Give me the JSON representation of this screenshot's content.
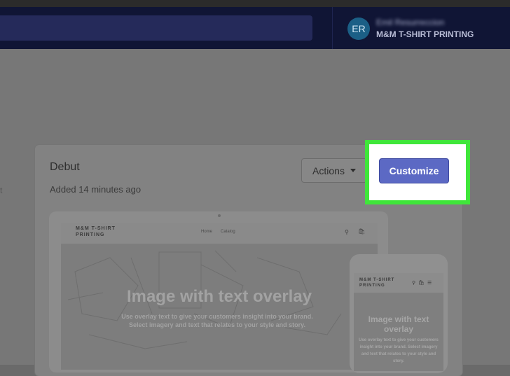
{
  "header": {
    "avatar_initials": "ER",
    "user_name": "Emil Resurreccion",
    "store_name": "M&M T-SHIRT PRINTING"
  },
  "sidebar": {
    "partial_text": "t"
  },
  "theme": {
    "name": "Debut",
    "added": "Added 14 minutes ago",
    "actions_label": "Actions",
    "customize_label": "Customize"
  },
  "preview": {
    "desktop": {
      "logo": "M&M T-SHIRT PRINTING",
      "nav_home": "Home",
      "nav_catalog": "Catalog",
      "heading": "Image with text overlay",
      "body": "Use overlay text to give your customers insight into your brand. Select imagery and text that relates to your style and story."
    },
    "mobile": {
      "logo": "M&M T-SHIRT PRINTING",
      "heading": "Image with text overlay",
      "body": "Use overlay text to give your customers insight into your brand. Select imagery and text that relates to your style and story."
    }
  },
  "icons": {
    "search": "search-icon",
    "bag": "shopping-bag-icon",
    "menu": "hamburger-menu-icon",
    "caret": "caret-down-icon"
  },
  "colors": {
    "topbar": "#101535",
    "customize_button": "#5c69c4",
    "highlight": "#3fe63a"
  }
}
